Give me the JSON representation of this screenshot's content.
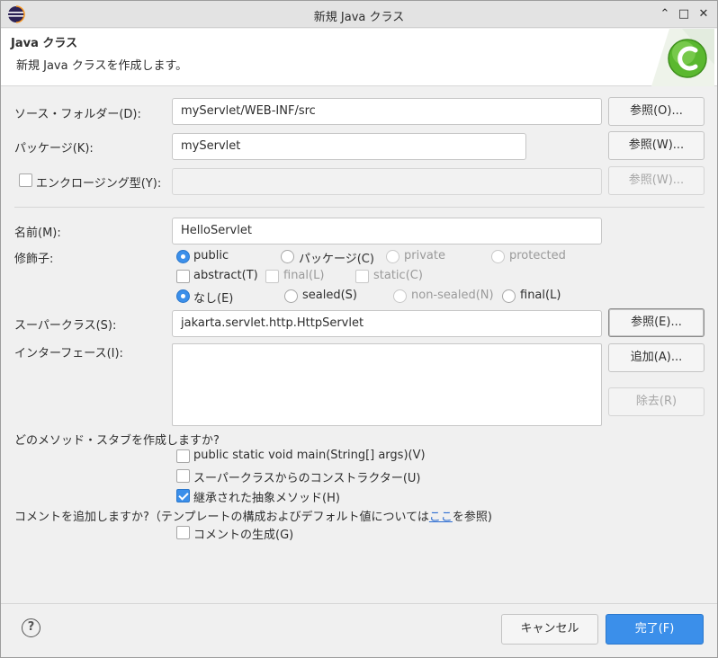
{
  "window": {
    "title": "新規 Java クラス",
    "minimize": "⌃",
    "maximize": "□",
    "close": "✕"
  },
  "header": {
    "title": "Java クラス",
    "description": "新規 Java クラスを作成します。"
  },
  "source_folder": {
    "label": "ソース・フォルダー(D):",
    "value": "myServlet/WEB-INF/src",
    "browse": "参照(O)..."
  },
  "package": {
    "label": "パッケージ(K):",
    "value": "myServlet",
    "browse": "参照(W)..."
  },
  "enclosing": {
    "label": "エンクロージング型(Y):",
    "value": "",
    "browse": "参照(W)..."
  },
  "name": {
    "label": "名前(M):",
    "value": "HelloServlet"
  },
  "modifiers": {
    "label": "修飾子:",
    "access": [
      "public",
      "パッケージ(C)",
      "private",
      "protected"
    ],
    "flags": [
      "abstract(T)",
      "final(L)",
      "static(C)"
    ],
    "sealing": [
      "なし(E)",
      "sealed(S)",
      "non-sealed(N)",
      "final(L)"
    ]
  },
  "superclass": {
    "label": "スーパークラス(S):",
    "value": "jakarta.servlet.http.HttpServlet",
    "browse": "参照(E)..."
  },
  "interfaces": {
    "label": "インターフェース(I):",
    "add": "追加(A)...",
    "remove": "除去(R)"
  },
  "stubs": {
    "question": "どのメソッド・スタブを作成しますか?",
    "main": "public static void main(String[] args)(V)",
    "constructors": "スーパークラスからのコンストラクター(U)",
    "inherited": "継承された抽象メソッド(H)"
  },
  "comments": {
    "question_pre": "コメントを追加しますか?（テンプレートの構成およびデフォルト値については",
    "link": "ここ",
    "question_post": "を参照)",
    "generate": "コメントの生成(G)"
  },
  "footer": {
    "help": "?",
    "cancel": "キャンセル",
    "finish": "完了(F)"
  },
  "colors": {
    "accent": "#3b8fea",
    "link": "#2a6bd1"
  }
}
